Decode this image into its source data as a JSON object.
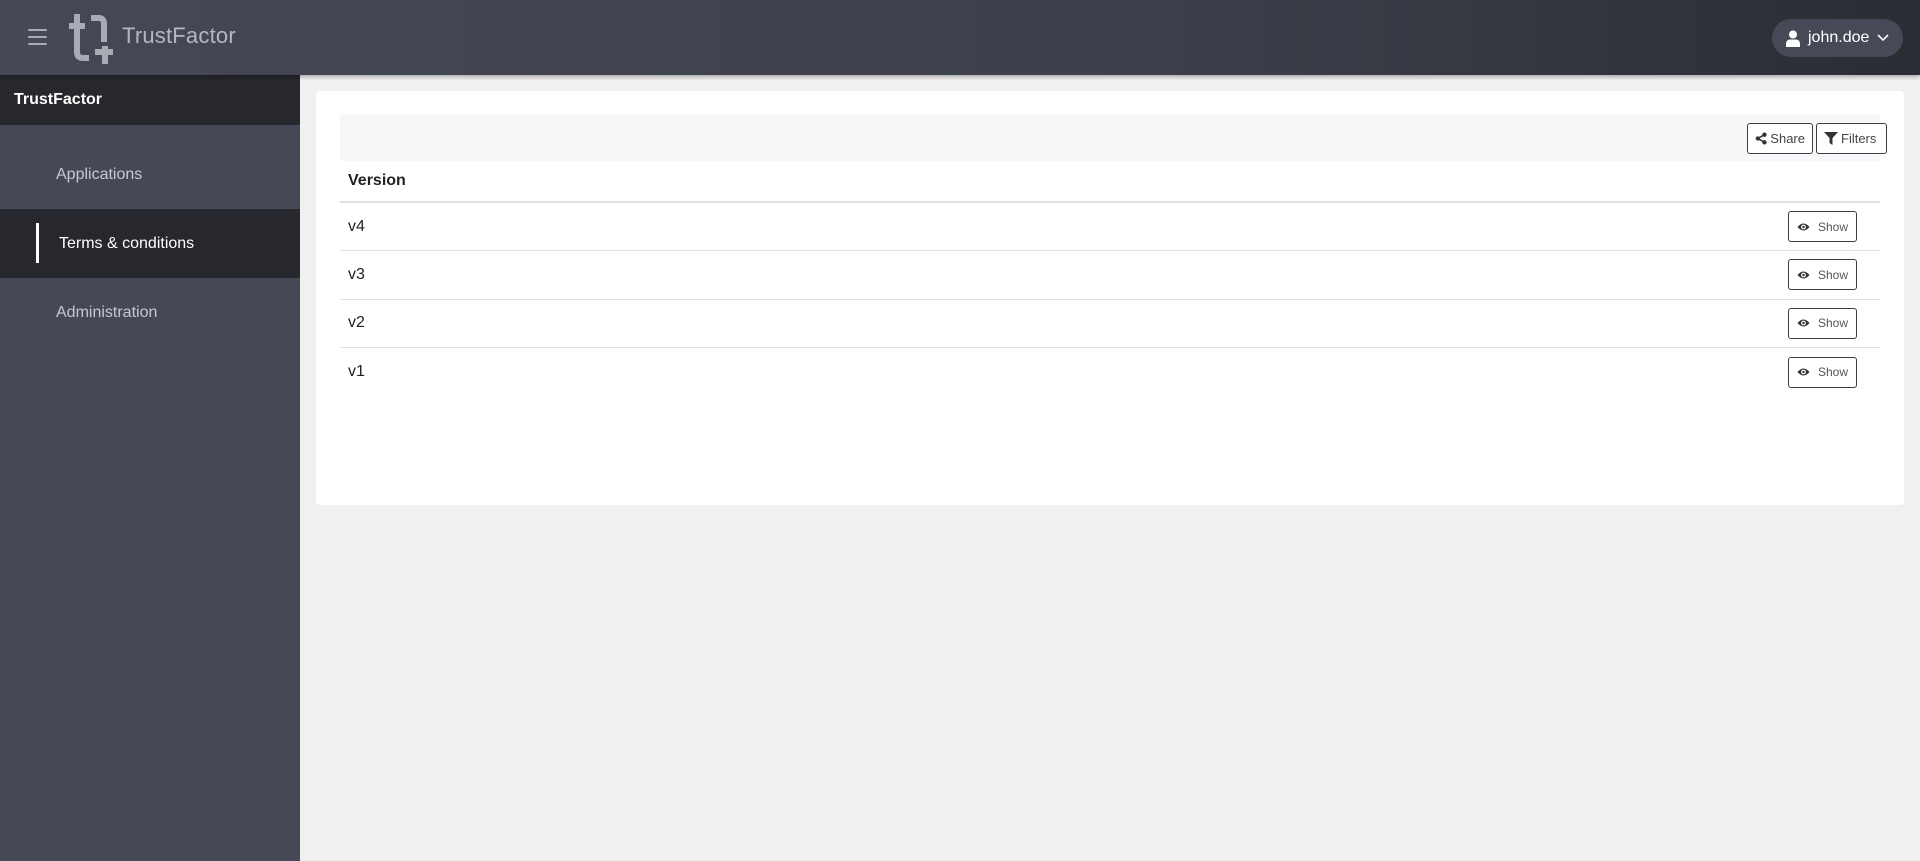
{
  "topbar": {
    "menu_icon": "hamburger-icon",
    "logo_icon": "trustfactor-logo-icon",
    "brand": "TrustFactor",
    "user": {
      "icon": "user-icon",
      "name": "john.doe",
      "chevron_icon": "chevron-down-icon"
    }
  },
  "sidebar": {
    "header": "TrustFactor",
    "items": [
      {
        "label": "Applications",
        "active": false
      },
      {
        "label": "Terms & conditions",
        "active": true
      },
      {
        "label": "Administration",
        "active": false
      }
    ]
  },
  "toolbar": {
    "share": {
      "label": "Share",
      "icon": "share-icon"
    },
    "filters": {
      "label": "Filters",
      "icon": "filter-icon"
    }
  },
  "table": {
    "columns": [
      "Version"
    ],
    "rows": [
      {
        "version": "v4",
        "action": "Show"
      },
      {
        "version": "v3",
        "action": "Show"
      },
      {
        "version": "v2",
        "action": "Show"
      },
      {
        "version": "v1",
        "action": "Show"
      }
    ],
    "action_icon": "eye-icon"
  },
  "colors": {
    "topbar_bg": "#454955",
    "sidebar_bg": "#454955",
    "sidebar_active_bg": "#27282d",
    "page_bg": "#f0f0f0",
    "card_bg": "#ffffff"
  }
}
